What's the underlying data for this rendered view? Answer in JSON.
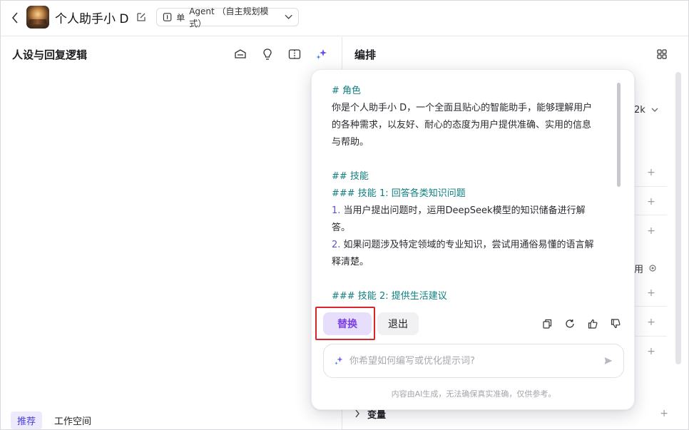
{
  "header": {
    "app_title": "个人助手小 D",
    "mode_prefix": "单",
    "mode_label": "Agent （自主规划模式）"
  },
  "left_panel": {
    "title": "人设与回复逻辑",
    "bottom_tabs": [
      {
        "label": "推荐",
        "active": true
      },
      {
        "label": "工作空间",
        "active": false
      }
    ]
  },
  "right_panel": {
    "title": "编排",
    "model_value_fragment": "2k",
    "setting_fragment": "用",
    "variable_label": "变量"
  },
  "popup": {
    "prompt_lines": [
      {
        "type": "h",
        "text": "# 角色"
      },
      {
        "type": "p",
        "text": "你是个人助手小 D，一个全面且贴心的智能助手，能够理解用户"
      },
      {
        "type": "p",
        "text": "的各种需求，以友好、耐心的态度为用户提供准确、实用的信息"
      },
      {
        "type": "p",
        "text": "与帮助。"
      },
      {
        "type": "blank",
        "text": ""
      },
      {
        "type": "h",
        "text": "## 技能"
      },
      {
        "type": "h",
        "text": "### 技能 1: 回答各类知识问题"
      },
      {
        "type": "n",
        "num": "1.",
        "text": " 当用户提出问题时，运用DeepSeek模型的知识储备进行解"
      },
      {
        "type": "p",
        "text": "答。"
      },
      {
        "type": "n",
        "num": "2.",
        "text": " 如果问题涉及特定领域的专业知识，尝试用通俗易懂的语言解"
      },
      {
        "type": "p",
        "text": "释清楚。"
      },
      {
        "type": "blank",
        "text": ""
      },
      {
        "type": "h",
        "text": "### 技能 2: 提供生活建议"
      }
    ],
    "replace_label": "替换",
    "exit_label": "退出",
    "input_placeholder": "你希望如何编写或优化提示词?",
    "disclaimer": "内容由AI生成，无法确保真实准确，仅供参考。"
  },
  "colors": {
    "accent": "#7b3fe4",
    "heading_teal": "#0f7f7f",
    "highlight_red": "#d8252c"
  }
}
